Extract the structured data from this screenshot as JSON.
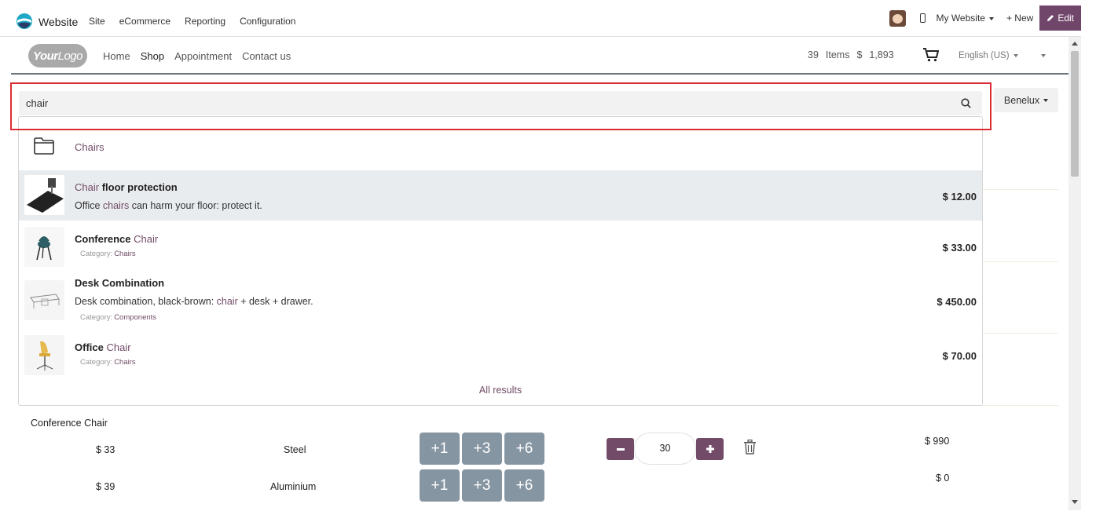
{
  "topbar": {
    "app_name": "Website",
    "menus": [
      "Site",
      "eCommerce",
      "Reporting",
      "Configuration"
    ],
    "my_website": "My Website",
    "new_label": "+ New",
    "edit_label": "Edit"
  },
  "site_header": {
    "logo_bold": "Your",
    "logo_light": "Logo",
    "nav": [
      "Home",
      "Shop",
      "Appointment",
      "Contact us"
    ],
    "active_nav": "Shop",
    "cart_count": "39",
    "cart_items_label": "Items",
    "currency": "$",
    "cart_total": "1,893",
    "language": "English (US)"
  },
  "pricelist": "Benelux",
  "search": {
    "value": "chair",
    "placeholder": ""
  },
  "dropdown": {
    "category_result": "Chairs",
    "results": [
      {
        "title_hl": "Chair",
        "title_rest": " floor protection",
        "desc_before": "Office ",
        "desc_hl": "chairs",
        "desc_after": " can harm your floor: protect it.",
        "category": "",
        "price": "$ 12.00"
      },
      {
        "title_plain": "Conference ",
        "title_hl": "Chair",
        "category_label": "Category:",
        "category": "Chairs",
        "price": "$ 33.00"
      },
      {
        "title_plain": "Desk Combination",
        "desc_before": "Desk combination, black-brown: ",
        "desc_hl": "chair",
        "desc_after": " + desk + drawer.",
        "category_label": "Category:",
        "category": "Components",
        "price": "$ 450.00"
      },
      {
        "title_plain": "Office ",
        "title_hl": "Chair",
        "category_label": "Category:",
        "category": "Chairs",
        "price": "$ 70.00"
      }
    ],
    "all_results": "All results"
  },
  "cart_table": {
    "product": "Conference Chair",
    "rows": [
      {
        "price": "$ 33",
        "material": "Steel",
        "buttons": [
          "+1",
          "+3",
          "+6"
        ],
        "qty": "30",
        "subtotal": "$ 990"
      },
      {
        "price": "$ 39",
        "material": "Aluminium",
        "buttons": [
          "+1",
          "+3",
          "+6"
        ],
        "subtotal": "$ 0"
      }
    ]
  },
  "colors": {
    "brand": "#714b67",
    "highlight_box": "#dc2c33",
    "qty_buttons": "#8695a2"
  }
}
